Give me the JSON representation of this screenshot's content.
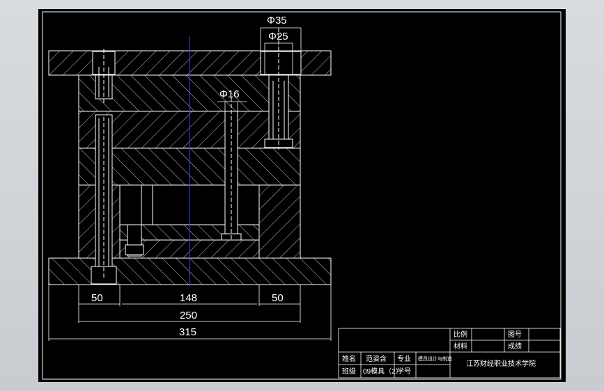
{
  "drawing": {
    "dimensions": {
      "phi35": "Φ35",
      "phi25": "Φ25",
      "phi16": "Φ16",
      "d50_left": "50",
      "d148": "148",
      "d50_right": "50",
      "d250": "250",
      "d315": "315"
    },
    "title_block": {
      "scale_label": "比例",
      "drawing_no_label": "图号",
      "material_label": "材料",
      "score_label": "成绩",
      "name_label": "姓名",
      "name_value": "范姿含",
      "major_label": "专业",
      "major_value": "模具设计与制造",
      "class_label": "班级",
      "class_value": "09模具（2）",
      "student_no_label": "学号",
      "school": "江苏财经职业技术学院"
    },
    "colors": {
      "background": "#000000",
      "lines": "#ffffff",
      "centerline": "#2b3bd6",
      "frame": "#d9dcdf"
    }
  }
}
